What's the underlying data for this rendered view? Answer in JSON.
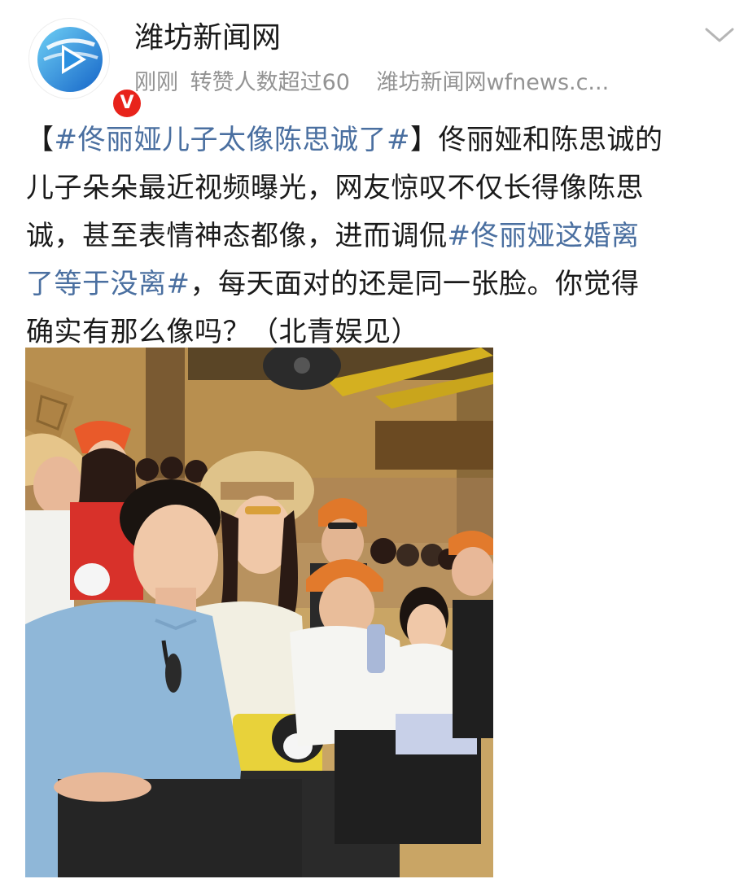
{
  "account": {
    "name": "潍坊新闻网",
    "avatar_icon": "wfnews-play-logo-icon",
    "verified_badge": "V",
    "time": "刚刚",
    "stats": "转赞人数超过60",
    "source": "潍坊新闻网wfnews.c..."
  },
  "header": {
    "menu_icon": "chevron-down-icon"
  },
  "post": {
    "lines": [
      [
        {
          "text": "【",
          "hashtag": false
        },
        {
          "text": "#佟丽娅儿子太像陈思诚了#",
          "hashtag": true
        },
        {
          "text": "】佟丽娅和陈思诚的",
          "hashtag": false
        }
      ],
      [
        {
          "text": "儿子朵朵最近视频曝光，网友惊叹不仅长得像陈思",
          "hashtag": false
        }
      ],
      [
        {
          "text": "诚，甚至表情神态都像，进而调侃",
          "hashtag": false
        },
        {
          "text": "#佟丽娅这婚离",
          "hashtag": true
        }
      ],
      [
        {
          "text": "了等于没离#",
          "hashtag": true
        },
        {
          "text": "，每天面对的还是同一张脸。你觉得",
          "hashtag": false
        }
      ],
      [
        {
          "text": "确实有那么像吗？（北青娱见）",
          "hashtag": false
        }
      ]
    ]
  },
  "colors": {
    "hashtag": "#4a6fa0",
    "text": "#1a1a1a",
    "meta": "#939393",
    "badge": "#e8231b",
    "logo_blue": "#1e8fe0"
  },
  "photo": {
    "subject": "photo-of-audience-at-theme-park-show"
  }
}
